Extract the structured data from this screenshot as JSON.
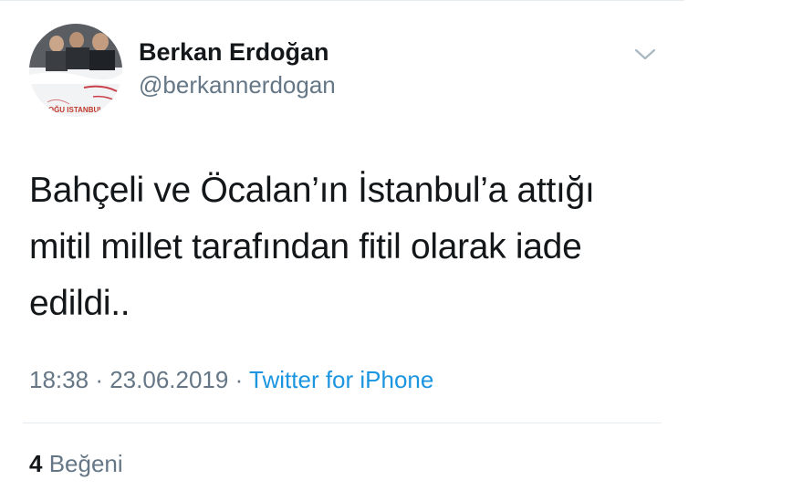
{
  "tweet": {
    "author": {
      "display_name": "Berkan Erdoğan",
      "handle": "@berkannerdogan",
      "avatar_banner_text": "OĞU ISTANBUL"
    },
    "text_lines": [
      "Bahçeli ve Öcalan’ın İstanbul’a attığı",
      "mitil millet tarafından fitil olarak iade",
      "edildi.."
    ],
    "time": "18:38",
    "separator": "·",
    "date": "23.06.2019",
    "source": "Twitter for iPhone",
    "likes": {
      "count": "4",
      "label": "Beğeni"
    },
    "menu_icon": "chevron-down-icon"
  },
  "colors": {
    "text_primary": "#14171a",
    "text_secondary": "#657786",
    "link": "#1b95e0",
    "divider": "#e6ecf0"
  }
}
